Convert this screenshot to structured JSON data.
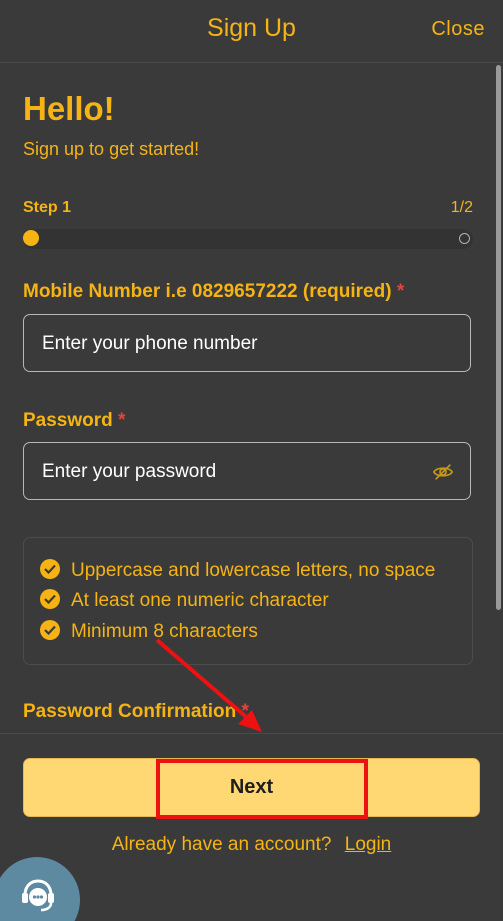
{
  "header": {
    "title": "Sign Up",
    "close_label": "Close"
  },
  "intro": {
    "greeting": "Hello!",
    "subtitle": "Sign up to get started!"
  },
  "progress": {
    "step_label": "Step 1",
    "step_count": "1/2",
    "fraction": 0.5
  },
  "form": {
    "mobile": {
      "label": "Mobile Number i.e 0829657222 (required)",
      "required_mark": "*",
      "placeholder": "Enter your phone number",
      "value": ""
    },
    "password": {
      "label": "Password",
      "required_mark": "*",
      "placeholder": "Enter your password",
      "value": "",
      "toggle_icon": "eye-off-icon"
    },
    "password_rules": [
      "Uppercase and lowercase letters, no space",
      "At least one numeric character",
      "Minimum 8 characters"
    ],
    "confirm": {
      "label": "Password Confirmation",
      "required_mark": "*"
    }
  },
  "footer": {
    "next_label": "Next",
    "account_prompt": "Already have an account?",
    "login_label": "Login"
  },
  "support": {
    "icon": "support-agent-icon"
  },
  "colors": {
    "accent": "#f5b414",
    "background": "#3a3a3a",
    "button": "#ffd874",
    "required": "#e0463c",
    "annotation": "#ee1111"
  }
}
